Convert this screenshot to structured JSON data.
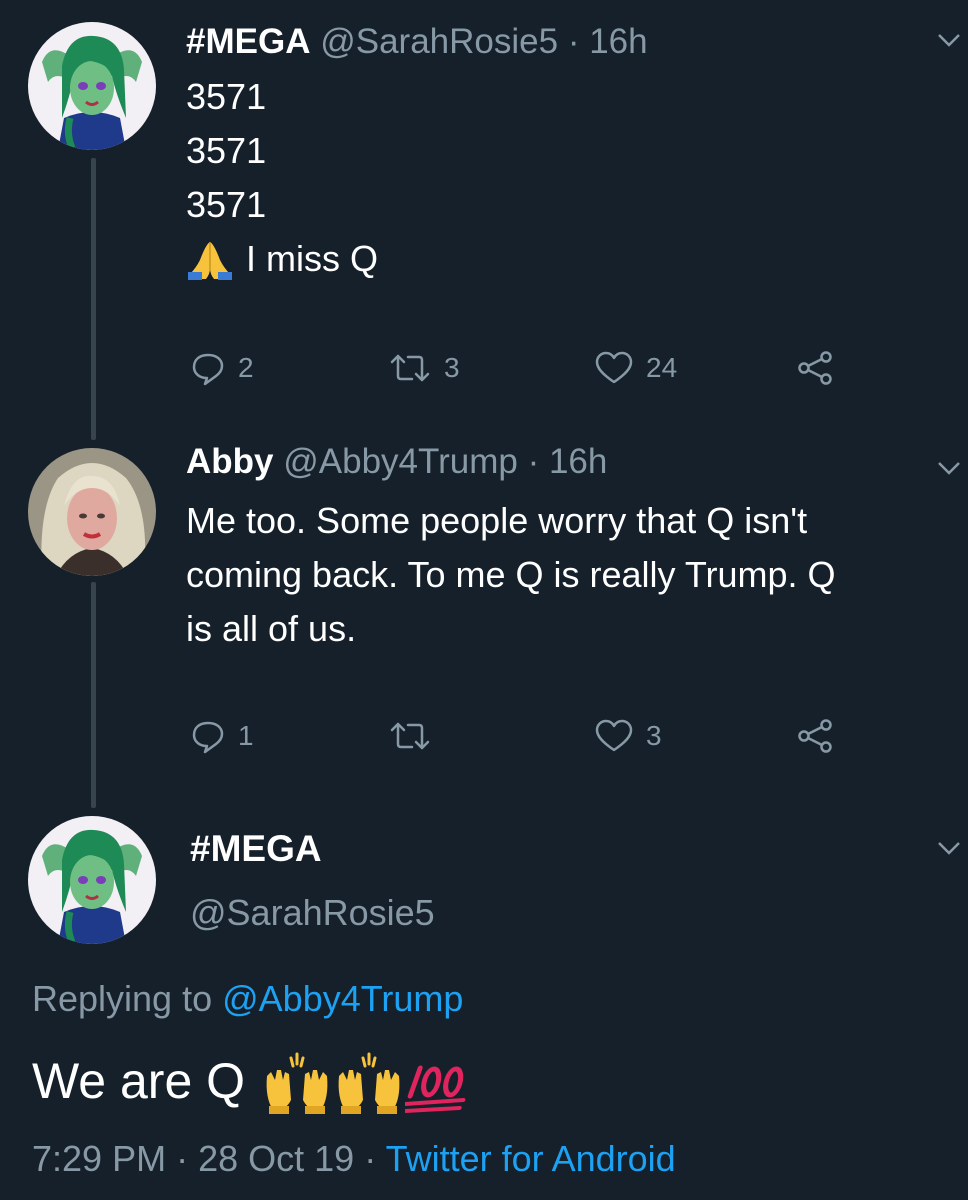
{
  "colors": {
    "background": "#15202b",
    "primary_text": "#ffffff",
    "secondary_text": "#8899a6",
    "link": "#1da1f2",
    "thread_line": "#38444d"
  },
  "tweets": [
    {
      "display_name": "#MEGA",
      "handle": "@SarahRosie5",
      "separator": "·",
      "time": "16h",
      "lines": [
        "3571",
        "3571",
        "3571",
        "I miss Q"
      ],
      "emoji_icon": "folded-hands-icon",
      "actions": {
        "reply_count": "2",
        "retweet_count": "3",
        "like_count": "24"
      }
    },
    {
      "display_name": "Abby",
      "handle": "@Abby4Trump",
      "separator": "·",
      "time": "16h",
      "lines": [
        "Me too. Some people worry that Q isn't",
        "coming back. To me Q is really Trump. Q",
        "is all of us."
      ],
      "actions": {
        "reply_count": "1",
        "retweet_count": "",
        "like_count": "3"
      }
    }
  ],
  "main_tweet": {
    "display_name": "#MEGA",
    "handle": "@SarahRosie5",
    "replying_prefix": "Replying to",
    "replying_to": "@Abby4Trump",
    "text": "We are Q",
    "emojis": [
      "raising-hands-icon",
      "raising-hands-icon",
      "hundred-points-icon"
    ],
    "time": "7:29 PM",
    "separator": "·",
    "date": "28 Oct 19",
    "source": "Twitter for Android"
  }
}
